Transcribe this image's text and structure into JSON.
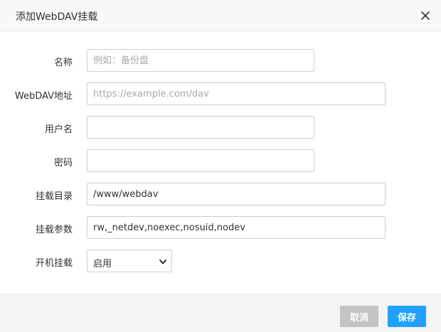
{
  "dialog": {
    "title": "添加WebDAV挂载",
    "close_label": "×"
  },
  "form": {
    "name": {
      "label": "名称",
      "value": "",
      "placeholder": "例如：备份盘"
    },
    "url": {
      "label": "WebDAV地址",
      "value": "",
      "placeholder": "https://example.com/dav"
    },
    "username": {
      "label": "用户名",
      "value": "",
      "placeholder": ""
    },
    "password": {
      "label": "密码",
      "value": "",
      "placeholder": ""
    },
    "mount_dir": {
      "label": "挂载目录",
      "value": "/www/webdav",
      "placeholder": ""
    },
    "mount_params": {
      "label": "挂载参数",
      "value": "rw,_netdev,noexec,nosuid,nodev",
      "placeholder": ""
    },
    "auto_mount": {
      "label": "开机挂载",
      "selected": "启用"
    }
  },
  "footer": {
    "cancel_label": "取消",
    "save_label": "保存"
  },
  "colors": {
    "primary": "#20a0ff",
    "cancel": "#c4c4c4",
    "header_bg": "#f8f8f8",
    "footer_bg": "#f4f4f4"
  },
  "icons": {
    "close": "close-icon",
    "select_arrow": "chevron-down-icon"
  }
}
